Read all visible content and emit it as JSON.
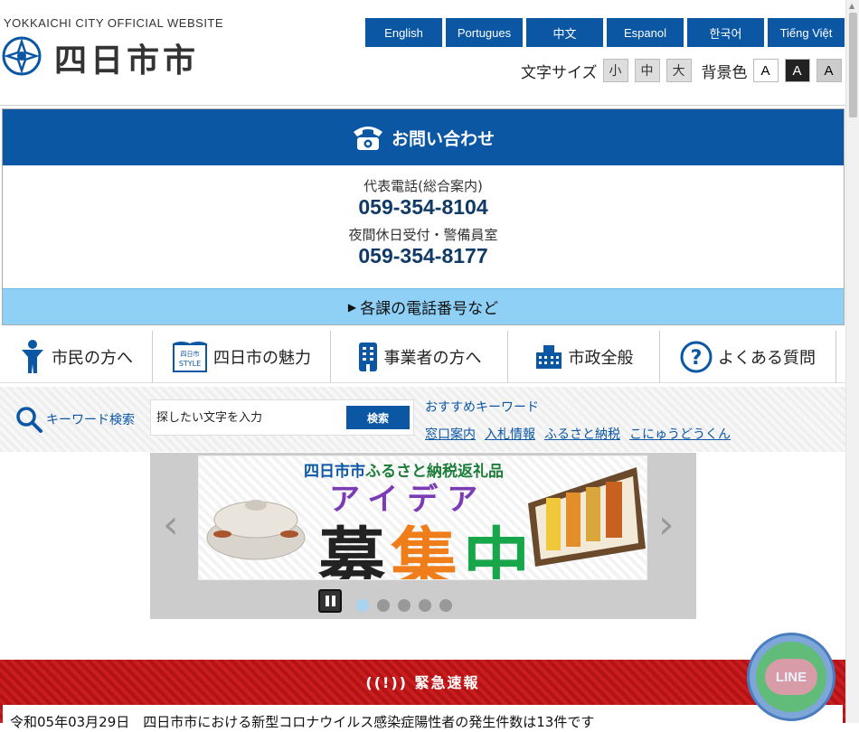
{
  "header": {
    "logo_subtitle": "YOKKAICHI CITY OFFICIAL WEBSITE",
    "logo_name": "四日市市",
    "languages": [
      "English",
      "Portugues",
      "中文",
      "Espanol",
      "한국어",
      "Tiếng Việt"
    ],
    "font_size_label": "文字サイズ",
    "font_sizes": [
      "小",
      "中",
      "大"
    ],
    "bg_color_label": "背景色",
    "bg_colors": [
      "A",
      "A",
      "A"
    ]
  },
  "contact": {
    "title": "お問い合わせ",
    "main_label": "代表電話(総合案内)",
    "main_tel": "059-354-8104",
    "night_label": "夜間休日受付・警備員室",
    "night_tel": "059-354-8177",
    "dept_link": "各課の電話番号など"
  },
  "nav": {
    "items": [
      "市民の方へ",
      "四日市の魅力",
      "事業者の方へ",
      "市政全般",
      "よくある質問"
    ]
  },
  "search": {
    "label": "キーワード検索",
    "placeholder": "探したい文字を入力",
    "button": "検索",
    "recommend_title": "おすすめキーワード",
    "recommend_links": [
      "窓口案内",
      "入札情報",
      "ふるさと納税",
      "こにゅうどうくん"
    ]
  },
  "slider": {
    "caption_a": "四日市市",
    "caption_b": "ふるさと納税返礼品",
    "title_line1": "アイデア",
    "title_line2_a": "募",
    "title_line2_b": "集",
    "title_line2_c": "中",
    "prev": "‹",
    "next": "›",
    "active_index": 0,
    "slide_count": 5
  },
  "emergency": {
    "title": "緊急速報",
    "message": "令和05年03月29日　四日市市における新型コロナウイルス感染症陽性者の発生件数は13件です"
  },
  "line": {
    "label": "LINE"
  },
  "colors": {
    "brand_blue": "#0b57a4",
    "light_blue": "#8fd0f6",
    "emergency_red": "#c91d20"
  }
}
